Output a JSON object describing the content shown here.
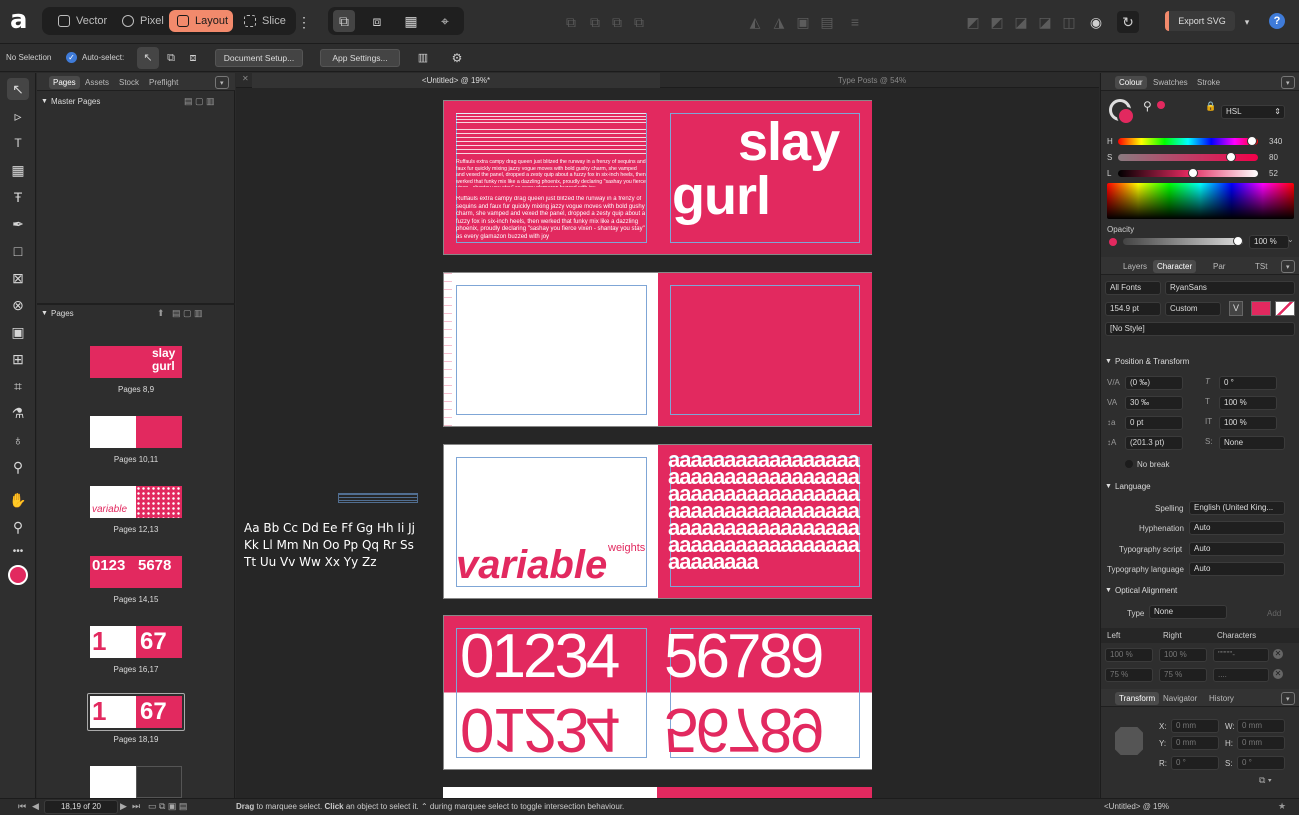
{
  "toolbar": {
    "personas": [
      {
        "label": "Vector",
        "active": false
      },
      {
        "label": "Pixel",
        "active": false
      },
      {
        "label": "Layout",
        "active": true
      },
      {
        "label": "Slice",
        "active": false
      }
    ],
    "export_label": "Export SVG",
    "help_label": "?"
  },
  "context": {
    "selection": "No Selection",
    "autoselect": "Auto-select:",
    "doc_setup": "Document Setup...",
    "app_settings": "App Settings..."
  },
  "left_panel": {
    "tabs": [
      "Pages",
      "Assets",
      "Stock",
      "Preflight"
    ],
    "master_pages": "Master Pages",
    "pages_header": "Pages",
    "thumbs": [
      {
        "label": "Pages 8,9",
        "text": "slay gurl"
      },
      {
        "label": "Pages 10,11"
      },
      {
        "label": "Pages 12,13",
        "text": "variable"
      },
      {
        "label": "Pages 14,15",
        "text": "01234 56789"
      },
      {
        "label": "Pages 16,17",
        "text": "1 67"
      },
      {
        "label": "Pages 18,19",
        "text": "1 67"
      }
    ]
  },
  "canvas": {
    "doc_tabs": [
      "<Untitled> @ 19%*",
      "Type Posts @ 54%"
    ],
    "alphabet": [
      "Aa Bb Cc Dd Ee Ff Gg Hh Ii Jj",
      "Kk Ll Mm Nn Oo Pp Qq Rr Ss",
      "Tt Uu Vv Ww Xx Yy Zz"
    ],
    "spread1_para": "Ruffauls extra campy drag queen just blitzed the runway in a frenzy of sequins and faux fur quickly mixing jazzy vogue moves with bold gushy charm, she vamped and vexed the panel, dropped a zesty quip about a fuzzy fox in six-inch heels, then werked that funky mix like a dazzling phoenix, proudly declaring \"sashay you fierce vixen - shantay you stay\" as every glamazon buzzed with joy",
    "slay": "slay",
    "gurl": "gurl",
    "variable": "variable",
    "weights": "weights",
    "aaa": "a",
    "digits_left": "01234",
    "digits_right": "56789"
  },
  "right_panel": {
    "colour_tabs": [
      "Colour",
      "Swatches",
      "Stroke"
    ],
    "model": "HSL",
    "hsl": {
      "H": "340",
      "S": "80",
      "L": "52"
    },
    "opacity_label": "Opacity",
    "opacity_value": "100 %",
    "char_tabs": [
      "Layers",
      "Character",
      "Par",
      "TSt"
    ],
    "font_collection": "All Fonts",
    "font_name": "RyanSans",
    "font_size": "154.9 pt",
    "weight": "Custom",
    "style": "[No Style]",
    "pos_transform": "Position & Transform",
    "kerning": "(0 ‰)",
    "tracking": "30 ‰",
    "baseline": "0 pt",
    "leading": "(201.3 pt)",
    "shear": "0 °",
    "hscale": "100 %",
    "vscale": "100 %",
    "caps": "None",
    "nobreak": "No break",
    "language": "Language",
    "spelling_label": "Spelling",
    "spelling": "English (United King...",
    "hyphenation_label": "Hyphenation",
    "hyphenation": "Auto",
    "script_label": "Typography script",
    "script": "Auto",
    "tlang_label": "Typography language",
    "tlang": "Auto",
    "optical": "Optical Alignment",
    "type_label": "Type",
    "type_value": "None",
    "add": "Add",
    "cols": [
      "Left",
      "Right",
      "Characters"
    ],
    "row1": [
      "100 %",
      "100 %",
      "\"\"\"'\"'-"
    ],
    "row2": [
      "75 %",
      "75 %",
      "...."
    ],
    "transform_tabs": [
      "Transform",
      "Navigator",
      "History"
    ],
    "tx": {
      "X": "0 mm",
      "Y": "0 mm",
      "W": "0 mm",
      "H": "0 mm",
      "R": "0 °",
      "S": "0 °"
    },
    "status_doc": "<Untitled> @ 19%"
  },
  "status": {
    "page": "18,19 of 20",
    "hint_drag": "Drag",
    "hint_1": " to marquee select. ",
    "hint_click": "Click",
    "hint_2": " an object to select it. ⌃ during marquee select to toggle intersection behaviour."
  },
  "colors": {
    "accent": "#e2295f",
    "persona_active": "#f28a6c",
    "panel": "#2e2e2e"
  }
}
